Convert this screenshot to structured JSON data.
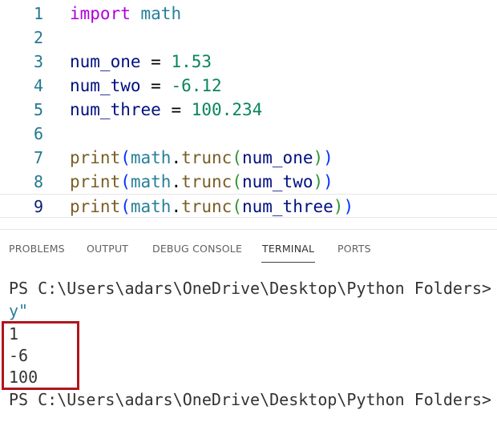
{
  "editor": {
    "lines": [
      {
        "n": "1",
        "parts": {
          "import_kw": "import",
          "module": "math"
        }
      },
      {
        "n": "2"
      },
      {
        "n": "3",
        "parts": {
          "var": "num_one",
          "eq": "=",
          "val": "1.53"
        }
      },
      {
        "n": "4",
        "parts": {
          "var": "num_two",
          "eq": "=",
          "val": "-6.12"
        }
      },
      {
        "n": "5",
        "parts": {
          "var": "num_three",
          "eq": "=",
          "val": "100.234"
        }
      },
      {
        "n": "6"
      },
      {
        "n": "7",
        "parts": {
          "fn": "print",
          "open1": "(",
          "mod": "math",
          "dot": ".",
          "attr": "trunc",
          "open2": "(",
          "arg": "num_one",
          "close2": ")",
          "close1": ")"
        }
      },
      {
        "n": "8",
        "parts": {
          "fn": "print",
          "open1": "(",
          "mod": "math",
          "dot": ".",
          "attr": "trunc",
          "open2": "(",
          "arg": "num_two",
          "close2": ")",
          "close1": ")"
        }
      },
      {
        "n": "9",
        "parts": {
          "fn": "print",
          "open1": "(",
          "mod": "math",
          "dot": ".",
          "attr": "trunc",
          "open2": "(",
          "arg": "num_three",
          "close2": ")",
          "close1": ")"
        }
      }
    ]
  },
  "panel": {
    "tabs": [
      "PROBLEMS",
      "OUTPUT",
      "DEBUG CONSOLE",
      "TERMINAL",
      "PORTS"
    ],
    "active_tab": "TERMINAL"
  },
  "terminal": {
    "prompt_line": "PS C:\\Users\\adars\\OneDrive\\Desktop\\Python Folders>",
    "wrap_line": "y\"",
    "outputs": [
      "1",
      "-6",
      "100"
    ],
    "prompt_line_2": "PS C:\\Users\\adars\\OneDrive\\Desktop\\Python Folders>"
  },
  "colors": {
    "keyword": "#af00db",
    "module": "#267f99",
    "variable": "#001080",
    "number": "#098658",
    "function": "#795e26",
    "highlight_box": "#b0161c"
  }
}
